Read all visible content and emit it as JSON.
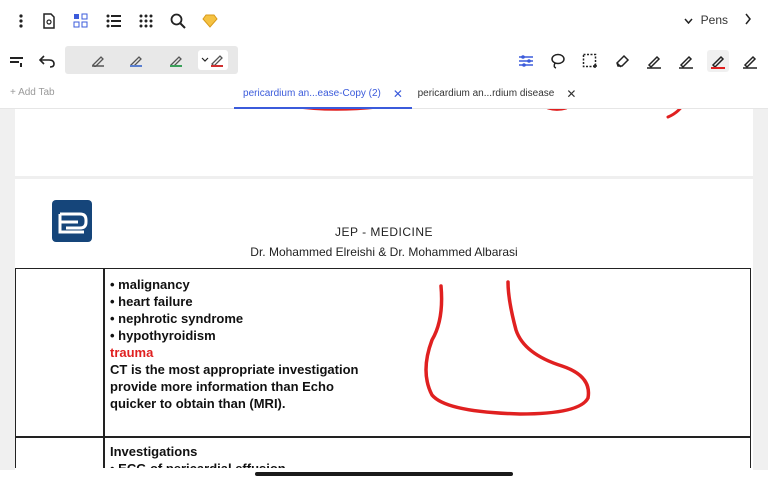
{
  "toolbar": {
    "pens_label": "Pens",
    "icons": [
      "more-vertical-icon",
      "document-icon",
      "grid-view-icon",
      "list-icon",
      "apps-icon",
      "search-icon",
      "premium-diamond-icon"
    ]
  },
  "toolbar2": {
    "pen_colors": [
      "#555555",
      "#5a7fd0",
      "#3aa05a",
      "#d03030"
    ]
  },
  "tabs": {
    "add_label": "+ Add Tab",
    "items": [
      {
        "label": "pericardium an...ease-Copy (2)",
        "close": "✕"
      },
      {
        "label": "pericardium an...rdium disease",
        "close": "✕"
      }
    ]
  },
  "document": {
    "header_line1": "JEP -  MEDICINE",
    "header_line2": "Dr. Mohammed Elreishi & Dr. Mohammed Albarasi",
    "bullets": [
      "• malignancy",
      "• heart failure",
      "• nephrotic syndrome",
      "• hypothyroidism"
    ],
    "trauma": "trauma",
    "lines": [
      "CT is the most appropriate investigation",
      "provide more information than Echo",
      "quicker to obtain than (MRI)."
    ],
    "investigations_title": "Investigations",
    "investigations_first": "• ECG of pericardial effusion"
  },
  "colors": {
    "accent": "#3b5bdb",
    "ink": "#e02020",
    "logo": "#15457a"
  }
}
